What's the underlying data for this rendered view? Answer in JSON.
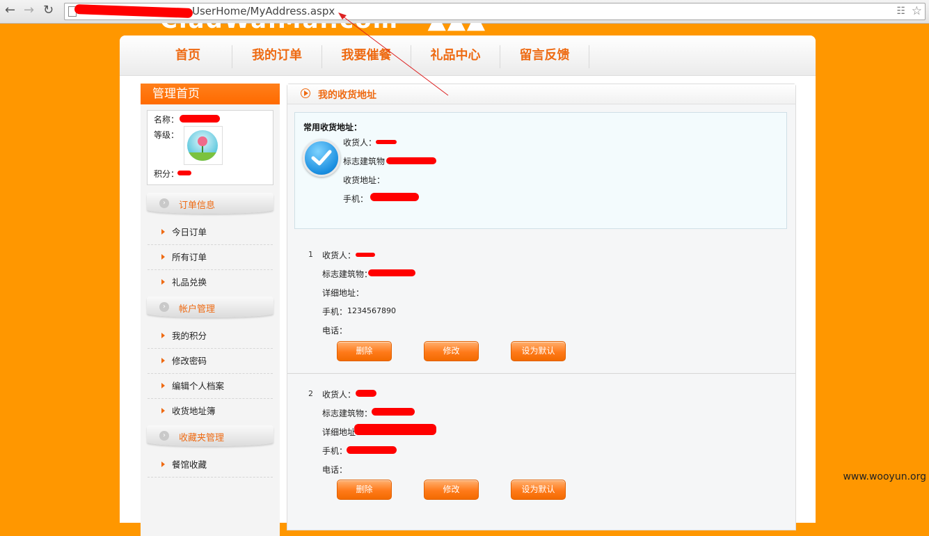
{
  "browser": {
    "url_text": "UserHome/MyAddress.aspx"
  },
  "topnav": {
    "items": [
      "首页",
      "我的订单",
      "我要催餐",
      "礼品中心",
      "留言反馈"
    ]
  },
  "sidebar": {
    "title": "管理首页",
    "user": {
      "name_label": "名称：",
      "level_label": "等级：",
      "points_label": "积分："
    },
    "sections": [
      {
        "title": "订单信息",
        "items": [
          "今日订单",
          "所有订单",
          "礼品兑换"
        ]
      },
      {
        "title": "帐户管理",
        "items": [
          "我的积分",
          "修改密码",
          "编辑个人档案",
          "收货地址簿"
        ]
      },
      {
        "title": "收藏夹管理",
        "items": [
          "餐馆收藏"
        ]
      }
    ]
  },
  "content": {
    "title": "我的收货地址",
    "default_address": {
      "heading": "常用收货地址：",
      "receiver_label": "收货人：",
      "landmark_label": "标志建筑物",
      "address_label": "收货地址：",
      "mobile_label": "手机："
    },
    "addresses": [
      {
        "index": "1",
        "receiver_label": "收货人：",
        "landmark_label": "标志建筑物：",
        "detail_label": "详细地址：",
        "mobile_label": "手机：",
        "mobile_value": "1234567890",
        "phone_label": "电话："
      },
      {
        "index": "2",
        "receiver_label": "收货人：",
        "landmark_label": "标志建筑物：",
        "detail_label": "详细地址",
        "mobile_label": "手机：",
        "phone_label": "电话："
      }
    ],
    "buttons": {
      "delete": "删除",
      "edit": "修改",
      "set_default": "设为默认"
    }
  },
  "watermark": "www.wooyun.org",
  "colors": {
    "background": "#ff9700",
    "accent": "#ee6a12",
    "redaction": "#ff0000"
  }
}
